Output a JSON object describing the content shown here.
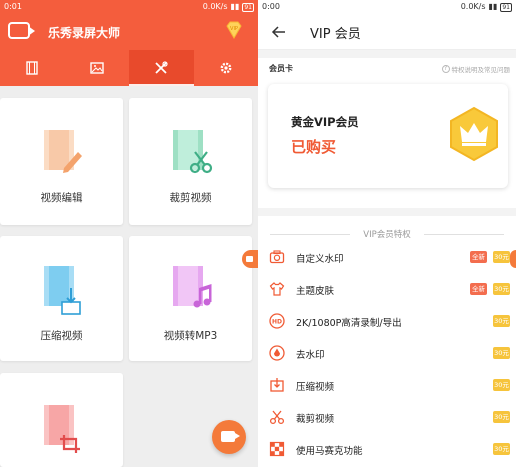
{
  "left": {
    "status": {
      "time": "0:01",
      "speed": "0.0K/s",
      "battery": "91"
    },
    "header": {
      "title": "乐秀录屏大师",
      "vip_badge": "VIP"
    },
    "tabs": [
      {
        "icon": "film-icon",
        "active": false
      },
      {
        "icon": "image-icon",
        "active": false
      },
      {
        "icon": "tools-icon",
        "active": true
      },
      {
        "icon": "gear-icon",
        "active": false
      }
    ],
    "tools": [
      {
        "label": "视频编辑",
        "icon": "video-edit-icon",
        "color": "#f8c9a8"
      },
      {
        "label": "裁剪视频",
        "icon": "video-cut-icon",
        "color": "#9ee0c4"
      },
      {
        "label": "压缩视频",
        "icon": "video-compress-icon",
        "color": "#7ecdf0"
      },
      {
        "label": "视频转MP3",
        "icon": "video-to-mp3-icon",
        "color": "#e6a8f0"
      },
      {
        "label": "",
        "icon": "video-crop-icon",
        "color": "#f7a6a6"
      }
    ],
    "accent": "#f45d3d"
  },
  "right": {
    "status": {
      "time": "0:00",
      "speed": "0.0K/s",
      "battery": "91"
    },
    "header": {
      "title": "VIP 会员"
    },
    "card_section": {
      "label": "会员卡",
      "hint": "特权说明及常见问题",
      "card_name": "黄金VIP会员",
      "card_status": "已购买"
    },
    "perks": {
      "title": "VIP会员特权",
      "items": [
        {
          "name": "自定义水印",
          "icon": "camera-icon",
          "new": "全新",
          "price": "30元"
        },
        {
          "name": "主题皮肤",
          "icon": "tshirt-icon",
          "new": "全新",
          "price": "30元"
        },
        {
          "name": "2K/1080P高清录制/导出",
          "icon": "hd-icon",
          "new": "",
          "price": "30元"
        },
        {
          "name": "去水印",
          "icon": "drop-icon",
          "new": "",
          "price": "30元"
        },
        {
          "name": "压缩视频",
          "icon": "compress-icon",
          "new": "",
          "price": "30元"
        },
        {
          "name": "裁剪视频",
          "icon": "scissors-icon",
          "new": "",
          "price": "30元"
        },
        {
          "name": "使用马赛克功能",
          "icon": "mosaic-icon",
          "new": "",
          "price": "30元"
        }
      ]
    }
  }
}
